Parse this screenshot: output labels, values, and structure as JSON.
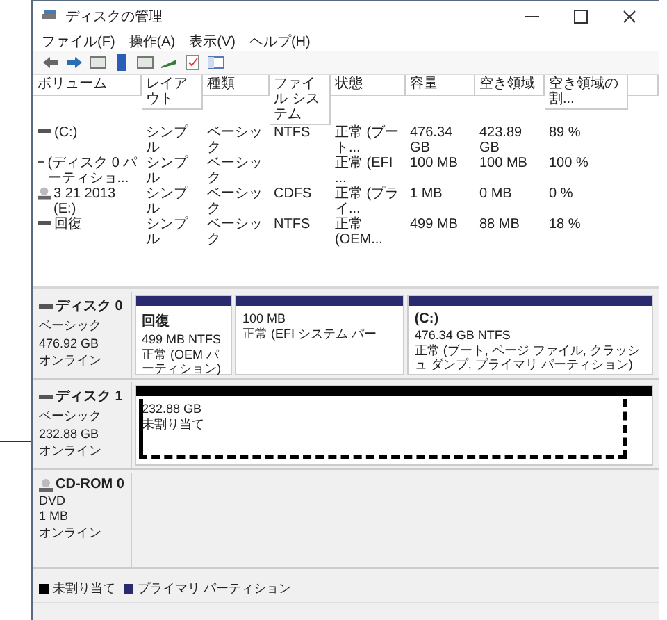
{
  "window": {
    "title": "ディスクの管理"
  },
  "menu": [
    "ファイル(F)",
    "操作(A)",
    "表示(V)",
    "ヘルプ(H)"
  ],
  "table": {
    "columns": [
      "ボリューム",
      "レイアウト",
      "種類",
      "ファイル システム",
      "状態",
      "容量",
      "空き領域",
      "空き領域の割..."
    ],
    "rows": [
      {
        "kind": "disk",
        "cells": [
          "(C:)",
          "シンプル",
          "ベーシック",
          "NTFS",
          "正常 (ブート...",
          "476.34 GB",
          "423.89 GB",
          "89 %"
        ]
      },
      {
        "kind": "disk",
        "cells": [
          "(ディスク 0 パーティショ...",
          "シンプル",
          "ベーシック",
          "",
          "正常 (EFI ...",
          "100 MB",
          "100 MB",
          "100 %"
        ]
      },
      {
        "kind": "cd",
        "cells": [
          "3 21 2013 (E:)",
          "シンプル",
          "ベーシック",
          "CDFS",
          "正常 (プライ...",
          "1 MB",
          "0 MB",
          "0 %"
        ]
      },
      {
        "kind": "disk",
        "cells": [
          "回復",
          "シンプル",
          "ベーシック",
          "NTFS",
          "正常 (OEM...",
          "499 MB",
          "88 MB",
          "18 %"
        ]
      }
    ]
  },
  "disks": [
    {
      "kind": "disk",
      "name": "ディスク 0",
      "lines": [
        "ベーシック",
        "476.92 GB",
        "オンライン"
      ],
      "partitions": [
        {
          "kind": "primary",
          "title": "回復",
          "size": "499 MB NTFS",
          "status": "正常 (OEM パーティション)"
        },
        {
          "kind": "primary",
          "size": "100 MB",
          "status": "正常 (EFI システム パー"
        },
        {
          "kind": "primary",
          "title": "(C:)",
          "size": "476.34 GB NTFS",
          "status": "正常 (ブート, ページ ファイル, クラッシュ ダンプ, プライマリ パーティション)"
        }
      ]
    },
    {
      "kind": "disk",
      "name": "ディスク 1",
      "lines": [
        "ベーシック",
        "232.88 GB",
        "オンライン"
      ],
      "highlighted": true,
      "partitions": [
        {
          "kind": "unallocated",
          "size": "232.88 GB",
          "status": "未割り当て"
        }
      ]
    },
    {
      "kind": "cdrom",
      "name": "CD-ROM 0",
      "lines": [
        "DVD",
        "1 MB",
        "オンライン"
      ]
    }
  ],
  "legend": [
    {
      "kind": "unallocated",
      "label": "未割り当て"
    },
    {
      "kind": "primary",
      "label": "プライマリ パーティション"
    }
  ]
}
